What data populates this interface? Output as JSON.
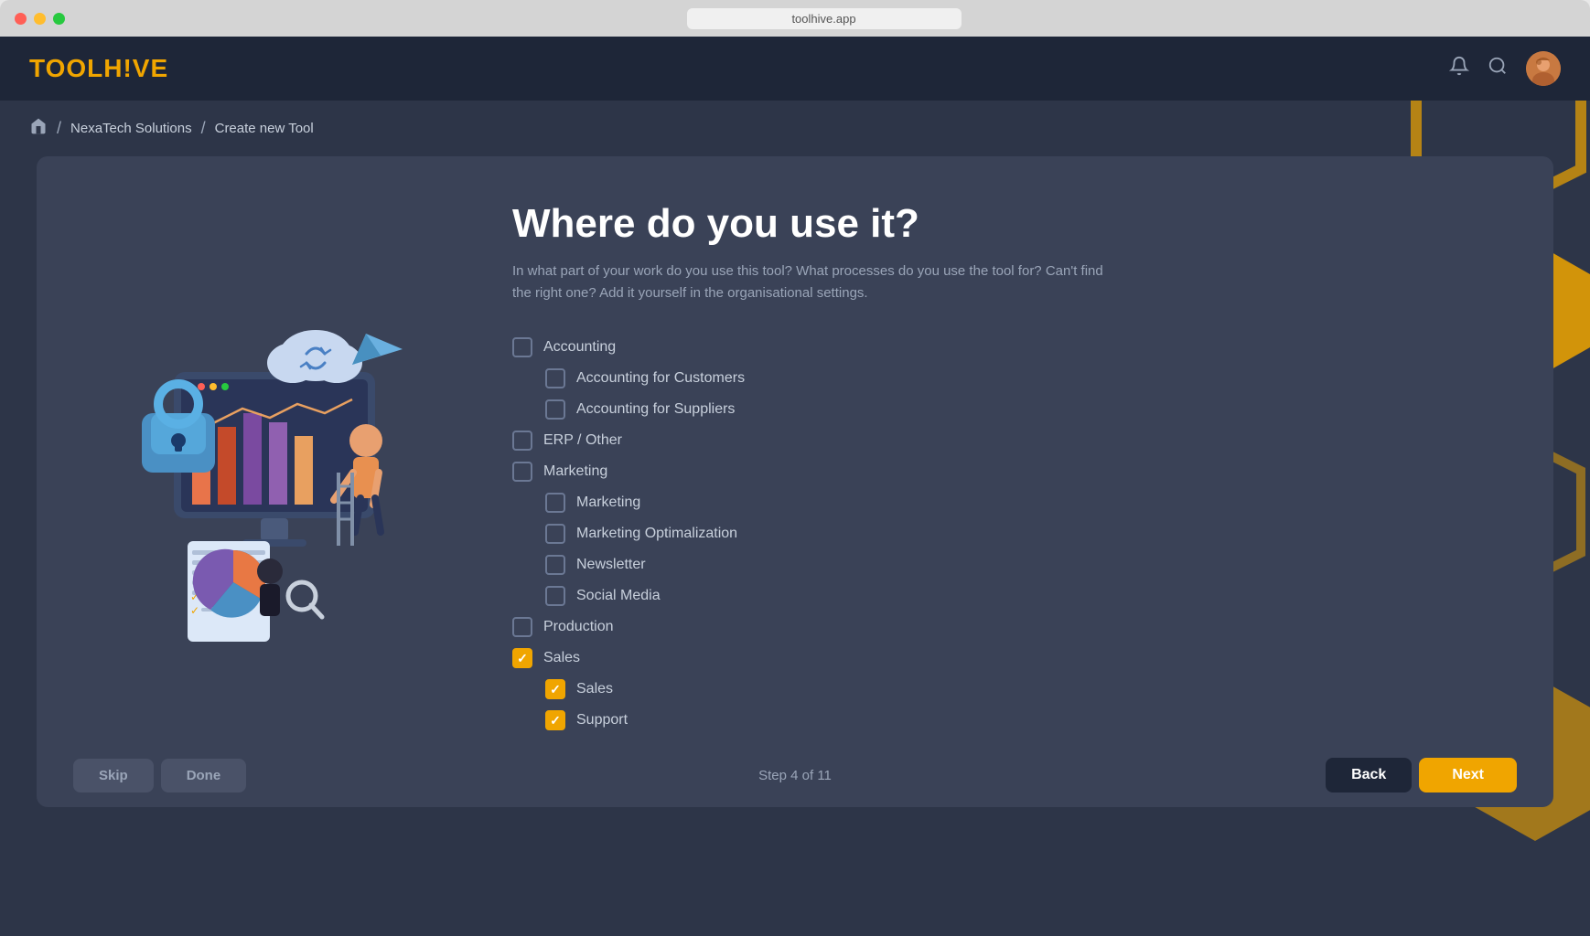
{
  "window": {
    "url": "toolhive.app"
  },
  "header": {
    "logo": "TOOLH!VE",
    "icons": {
      "bell": "🔔",
      "search": "🔍"
    }
  },
  "breadcrumb": {
    "home_icon": "🏠",
    "separator": "/",
    "company": "NexaTech Solutions",
    "current": "Create new Tool"
  },
  "form": {
    "title": "Where do you use it?",
    "subtitle": "In what part of your work do you use this tool? What processes do you use the tool for? Can't find the right one? Add it yourself in the organisational settings.",
    "categories": [
      {
        "id": "accounting",
        "label": "Accounting",
        "checked": false,
        "indent": 0,
        "children": [
          {
            "id": "accounting-customers",
            "label": "Accounting for Customers",
            "checked": false,
            "indent": 1
          },
          {
            "id": "accounting-suppliers",
            "label": "Accounting for Suppliers",
            "checked": false,
            "indent": 1
          }
        ]
      },
      {
        "id": "erp",
        "label": "ERP / Other",
        "checked": false,
        "indent": 0,
        "children": []
      },
      {
        "id": "marketing",
        "label": "Marketing",
        "checked": false,
        "indent": 0,
        "children": [
          {
            "id": "marketing-general",
            "label": "Marketing",
            "checked": false,
            "indent": 1
          },
          {
            "id": "marketing-optimization",
            "label": "Marketing Optimalization",
            "checked": false,
            "indent": 1
          },
          {
            "id": "newsletter",
            "label": "Newsletter",
            "checked": false,
            "indent": 1
          },
          {
            "id": "social-media",
            "label": "Social Media",
            "checked": false,
            "indent": 1
          }
        ]
      },
      {
        "id": "production",
        "label": "Production",
        "checked": false,
        "indent": 0,
        "children": []
      },
      {
        "id": "sales",
        "label": "Sales",
        "checked": true,
        "indent": 0,
        "children": [
          {
            "id": "sales-general",
            "label": "Sales",
            "checked": true,
            "indent": 1
          },
          {
            "id": "support",
            "label": "Support",
            "checked": true,
            "indent": 1
          }
        ]
      }
    ]
  },
  "footer": {
    "skip_label": "Skip",
    "done_label": "Done",
    "step_text": "Step 4 of 11",
    "back_label": "Back",
    "next_label": "Next"
  },
  "colors": {
    "accent": "#f0a500",
    "bg_dark": "#1e2638",
    "bg_mid": "#2d3548",
    "bg_card": "#3a4257",
    "text_muted": "#9aa5b8",
    "text_light": "#c8d0dc",
    "checked": "#f0a500"
  }
}
